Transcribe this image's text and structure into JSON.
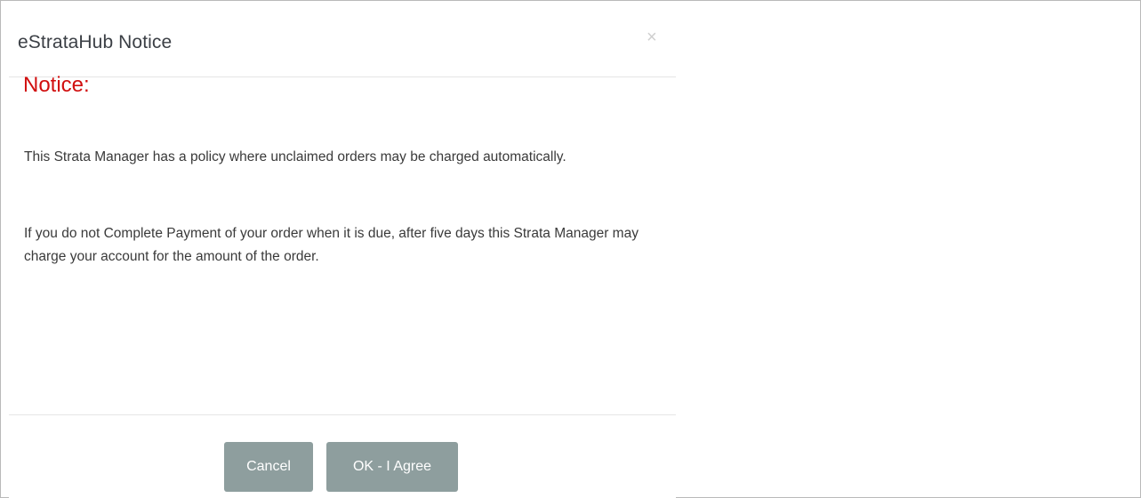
{
  "dialog": {
    "title": "eStrataHub Notice",
    "close_glyph": "×",
    "notice_heading": "Notice:",
    "paragraph1": "This Strata Manager has a policy where unclaimed orders may be charged automatically.",
    "paragraph2": "If you do not Complete Payment of your order when it is due, after five days this Strata Manager may charge your account for the amount of the order."
  },
  "buttons": {
    "cancel_label": "Cancel",
    "ok_label": "OK - I Agree"
  },
  "colors": {
    "notice_red": "#d10f0f",
    "button_gray": "#8e9e9e"
  }
}
